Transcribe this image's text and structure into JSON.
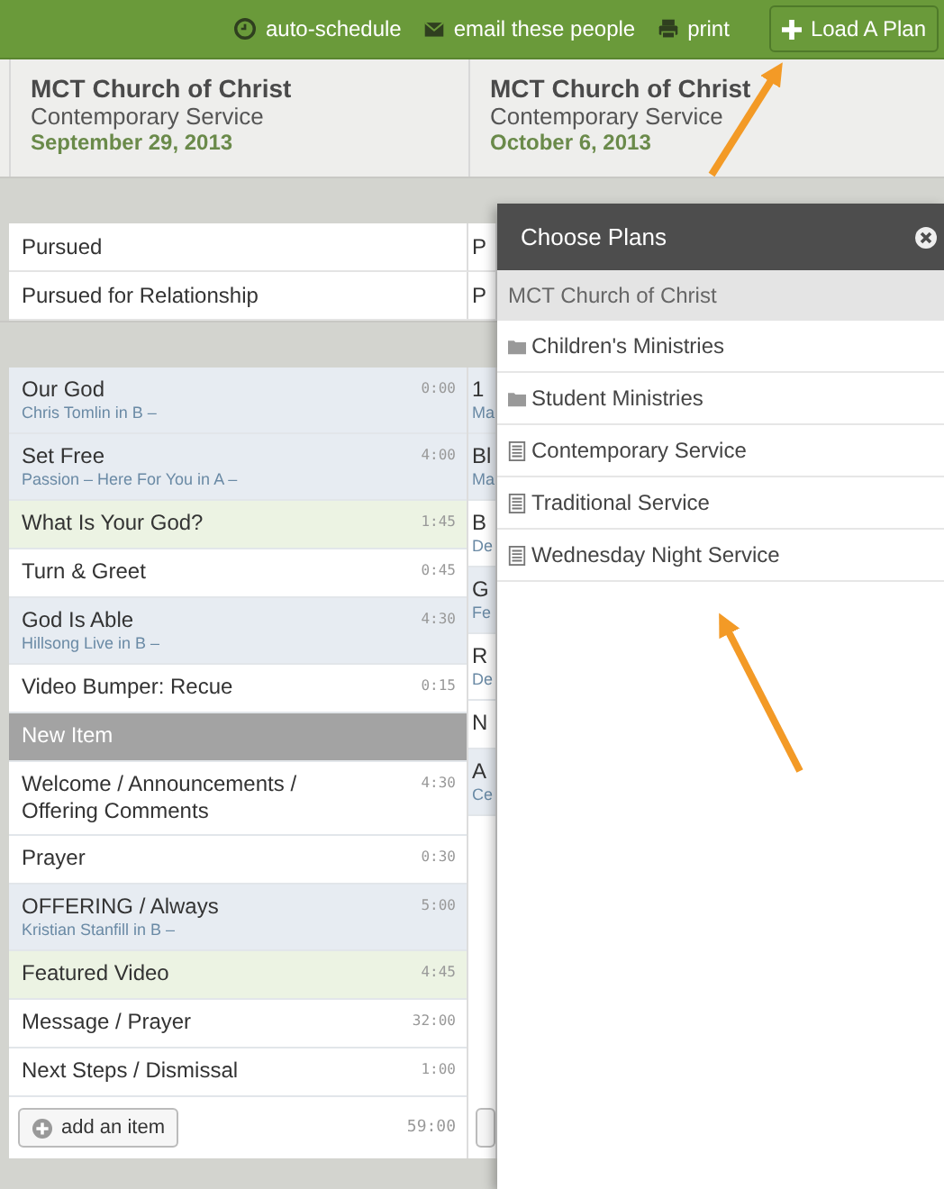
{
  "toolbar": {
    "links": [
      {
        "kind": "clock",
        "label": "auto-schedule"
      },
      {
        "kind": "mail",
        "label": "email these people"
      },
      {
        "kind": "print",
        "label": "print"
      }
    ],
    "button": "Load A Plan"
  },
  "plans": [
    {
      "church": "MCT Church of Christ",
      "service": "Contemporary Service",
      "date": "September 29, 2013",
      "notes": [
        "Pursued",
        "Pursued for Relationship"
      ],
      "items": [
        {
          "kind": "song",
          "title": "Our God",
          "subtitle": "Chris Tomlin in B –",
          "time": "0:00"
        },
        {
          "kind": "song",
          "title": "Set Free",
          "subtitle": "Passion – Here For You in A –",
          "time": "4:00"
        },
        {
          "kind": "media",
          "title": "What Is Your God?",
          "time": "1:45"
        },
        {
          "kind": "item",
          "title": "Turn & Greet",
          "time": "0:45"
        },
        {
          "kind": "song",
          "title": "God Is Able",
          "subtitle": "Hillsong Live in B –",
          "time": "4:30"
        },
        {
          "kind": "item",
          "title": "Video Bumper: Recue",
          "time": "0:15"
        },
        {
          "kind": "header",
          "title": "New Item"
        },
        {
          "kind": "item",
          "title": "Welcome / Announcements / Offering Comments",
          "time": "4:30"
        },
        {
          "kind": "item",
          "title": "Prayer",
          "time": "0:30"
        },
        {
          "kind": "song",
          "title": "OFFERING / Always",
          "subtitle": "Kristian Stanfill in B –",
          "time": "5:00"
        },
        {
          "kind": "media",
          "title": "Featured Video",
          "time": "4:45"
        },
        {
          "kind": "item",
          "title": "Message / Prayer",
          "time": "32:00"
        },
        {
          "kind": "item",
          "title": "Next Steps / Dismissal",
          "time": "1:00"
        }
      ],
      "add_button": "add an item",
      "total": "59:00"
    },
    {
      "church": "MCT Church of Christ",
      "service": "Contemporary Service",
      "date": "October 6, 2013",
      "notes": [
        "P",
        "P"
      ],
      "items": [
        {
          "kind": "song",
          "title": "1",
          "subtitle": "Ma"
        },
        {
          "kind": "song",
          "title": "Bl",
          "subtitle": "Ma"
        },
        {
          "kind": "item",
          "title": "B",
          "subtitle": "De"
        },
        {
          "kind": "song",
          "title": "G",
          "subtitle": "Fe"
        },
        {
          "kind": "item",
          "title": "R",
          "subtitle": "De"
        },
        {
          "kind": "item",
          "title": "N"
        },
        {
          "kind": "song",
          "title": "A",
          "subtitle": "Ce"
        }
      ]
    }
  ],
  "popup": {
    "title": "Choose Plans",
    "organization": "MCT Church of Christ",
    "items": [
      {
        "kind": "folder",
        "label": "Children's Ministries"
      },
      {
        "kind": "folder",
        "label": "Student Ministries"
      },
      {
        "kind": "plan",
        "label": "Contemporary Service"
      },
      {
        "kind": "plan",
        "label": "Traditional Service"
      },
      {
        "kind": "plan",
        "label": "Wednesday Night Service"
      }
    ]
  }
}
